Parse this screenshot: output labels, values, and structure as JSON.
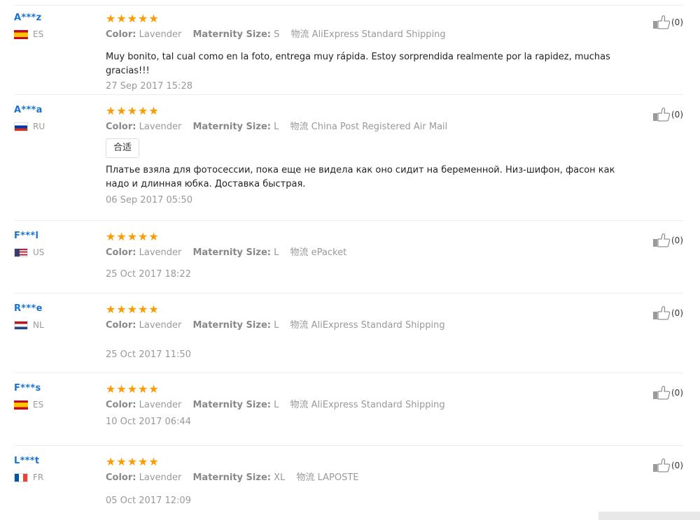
{
  "labels": {
    "color": "Color:",
    "size": "Maternity Size:",
    "shipping": "物流"
  },
  "colors": {
    "username": "#1a73d1",
    "star": "#ff9a00"
  },
  "reviews": [
    {
      "user": "A***z",
      "country": "ES",
      "rating": "★★★★★",
      "color": "Lavender",
      "size": "S",
      "shipping": "AliExpress Standard Shipping",
      "text": "Muy bonito, tal cual como en la foto, entrega muy rápida. Estoy sorprendida realmente por la rapidez, muchas gracias!!!",
      "date": "27 Sep 2017 15:28",
      "likes": "(0)"
    },
    {
      "user": "A***a",
      "country": "RU",
      "rating": "★★★★★",
      "color": "Lavender",
      "size": "L",
      "shipping": "China Post Registered Air Mail",
      "tag": "合适",
      "text": "Платье взяла для фотосессии, пока еще не видела как оно сидит на беременной. Низ-шифон, фасон как надо и длинная юбка. Доставка быстрая.",
      "date": "06 Sep 2017 05:50",
      "likes": "(0)"
    },
    {
      "user": "F***l",
      "country": "US",
      "rating": "★★★★★",
      "color": "Lavender",
      "size": "L",
      "shipping": "ePacket",
      "date": "25 Oct 2017 18:22",
      "likes": "(0)"
    },
    {
      "user": "R***e",
      "country": "NL",
      "rating": "★★★★★",
      "color": "Lavender",
      "size": "L",
      "shipping": "AliExpress Standard Shipping",
      "date": "25 Oct 2017 11:50",
      "likes": "(0)"
    },
    {
      "user": "F***s",
      "country": "ES",
      "rating": "★★★★★",
      "color": "Lavender",
      "size": "L",
      "shipping": "AliExpress Standard Shipping",
      "date": "10 Oct 2017 06:44",
      "likes": "(0)"
    },
    {
      "user": "L***t",
      "country": "FR",
      "rating": "★★★★★",
      "color": "Lavender",
      "size": "XL",
      "shipping": "LAPOSTE",
      "date": "05 Oct 2017 12:09",
      "likes": "(0)"
    }
  ]
}
